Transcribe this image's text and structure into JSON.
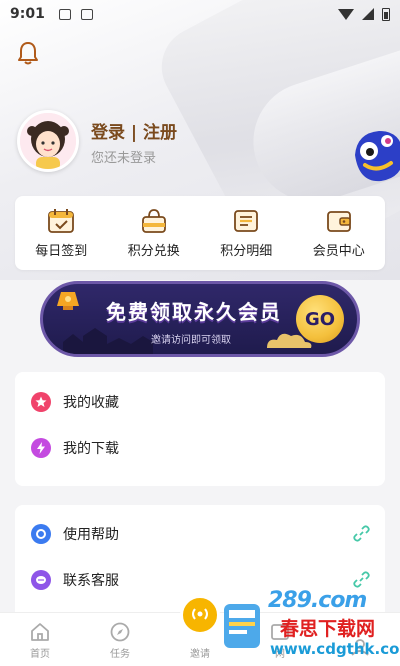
{
  "status_bar": {
    "time": "9:01"
  },
  "profile": {
    "login_label": "登录 | 注册",
    "subtitle": "您还未登录"
  },
  "quick_actions": [
    {
      "label": "每日签到",
      "icon": "calendar-icon"
    },
    {
      "label": "积分兑换",
      "icon": "basket-icon"
    },
    {
      "label": "积分明细",
      "icon": "list-icon"
    },
    {
      "label": "会员中心",
      "icon": "wallet-icon"
    }
  ],
  "banner": {
    "title": "免费领取永久会员",
    "subtitle": "邀请访问即可领取",
    "button": "GO"
  },
  "menu_group1": [
    {
      "label": "我的收藏",
      "icon": "star-icon",
      "color": "#f0436b"
    },
    {
      "label": "我的下载",
      "icon": "lightning-icon",
      "color": "#c44ae0"
    }
  ],
  "menu_group2": [
    {
      "label": "使用帮助",
      "icon": "help-icon",
      "color": "#3b7bf0"
    },
    {
      "label": "联系客服",
      "icon": "chat-icon",
      "color": "#8e55e8"
    }
  ],
  "tabbar": [
    {
      "label": "首页",
      "icon": "home-icon"
    },
    {
      "label": "任务",
      "icon": "compass-icon"
    },
    {
      "label": "邀请",
      "icon": "broadcast-icon"
    },
    {
      "label": "网",
      "icon": "web-icon"
    },
    {
      "label": "",
      "icon": "me-icon"
    }
  ],
  "watermark": {
    "logo": "289.com",
    "name": "春思下载网",
    "domain": "www.cdgthk.com"
  },
  "colors": {
    "accent_brown": "#7a4a1d",
    "gold": "#c98a1c",
    "banner_bg": "#2a2460",
    "link_green": "#46c8a8"
  }
}
